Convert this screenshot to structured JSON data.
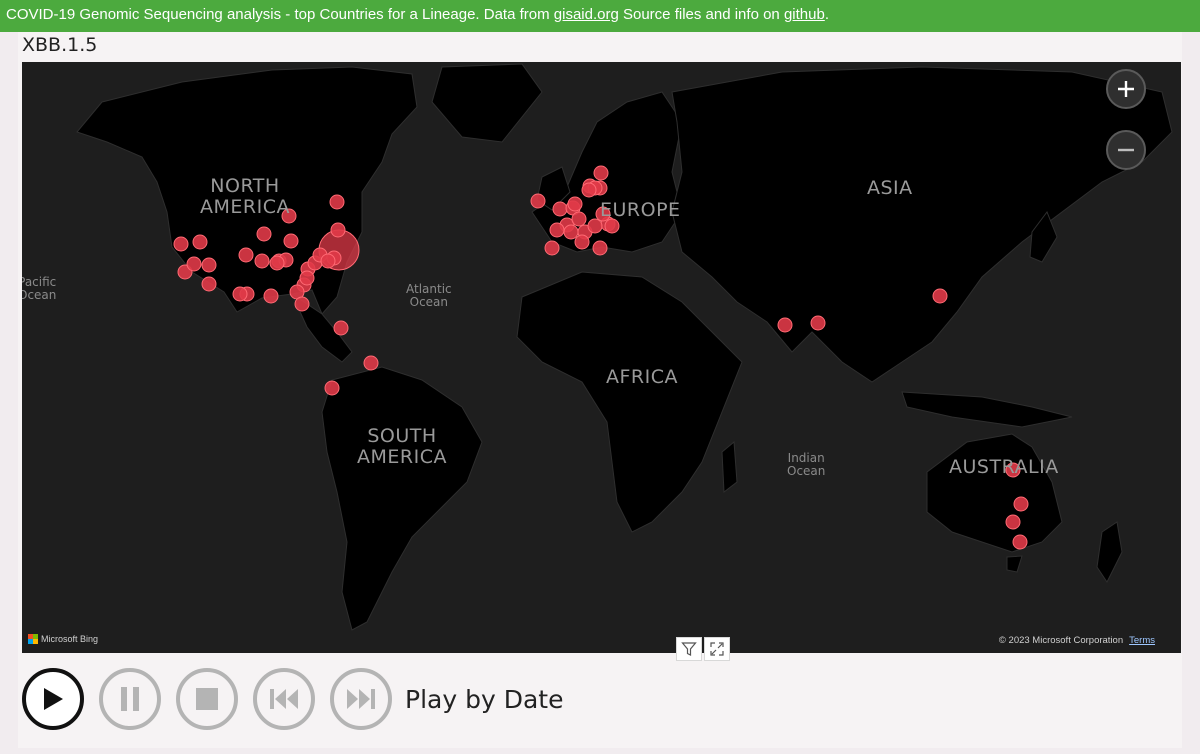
{
  "banner": {
    "prefix": "COVID-19 Genomic Sequencing analysis - top Countries for a Lineage. Data from ",
    "link1": "gisaid.org",
    "middle": " Source files and info on ",
    "link2": "github",
    "suffix": "."
  },
  "lineage": "XBB.1.5",
  "map": {
    "continents": {
      "north_america": "NORTH\nAMERICA",
      "south_america": "SOUTH\nAMERICA",
      "europe": "EUROPE",
      "asia": "ASIA",
      "africa": "AFRICA",
      "australia": "AUSTRALIA"
    },
    "oceans": {
      "pacific": "Pacific\nOcean",
      "atlantic": "Atlantic\nOcean",
      "indian": "Indian\nOcean"
    },
    "provider": "Microsoft Bing",
    "copyright": "© 2023 Microsoft Corporation",
    "terms": "Terms",
    "marker_color": "#e03a48",
    "land_color": "#000000",
    "water_color": "#1e1e1e"
  },
  "controls": {
    "buttons": [
      "play",
      "pause",
      "stop",
      "previous",
      "next"
    ],
    "label": "Play by Date"
  }
}
